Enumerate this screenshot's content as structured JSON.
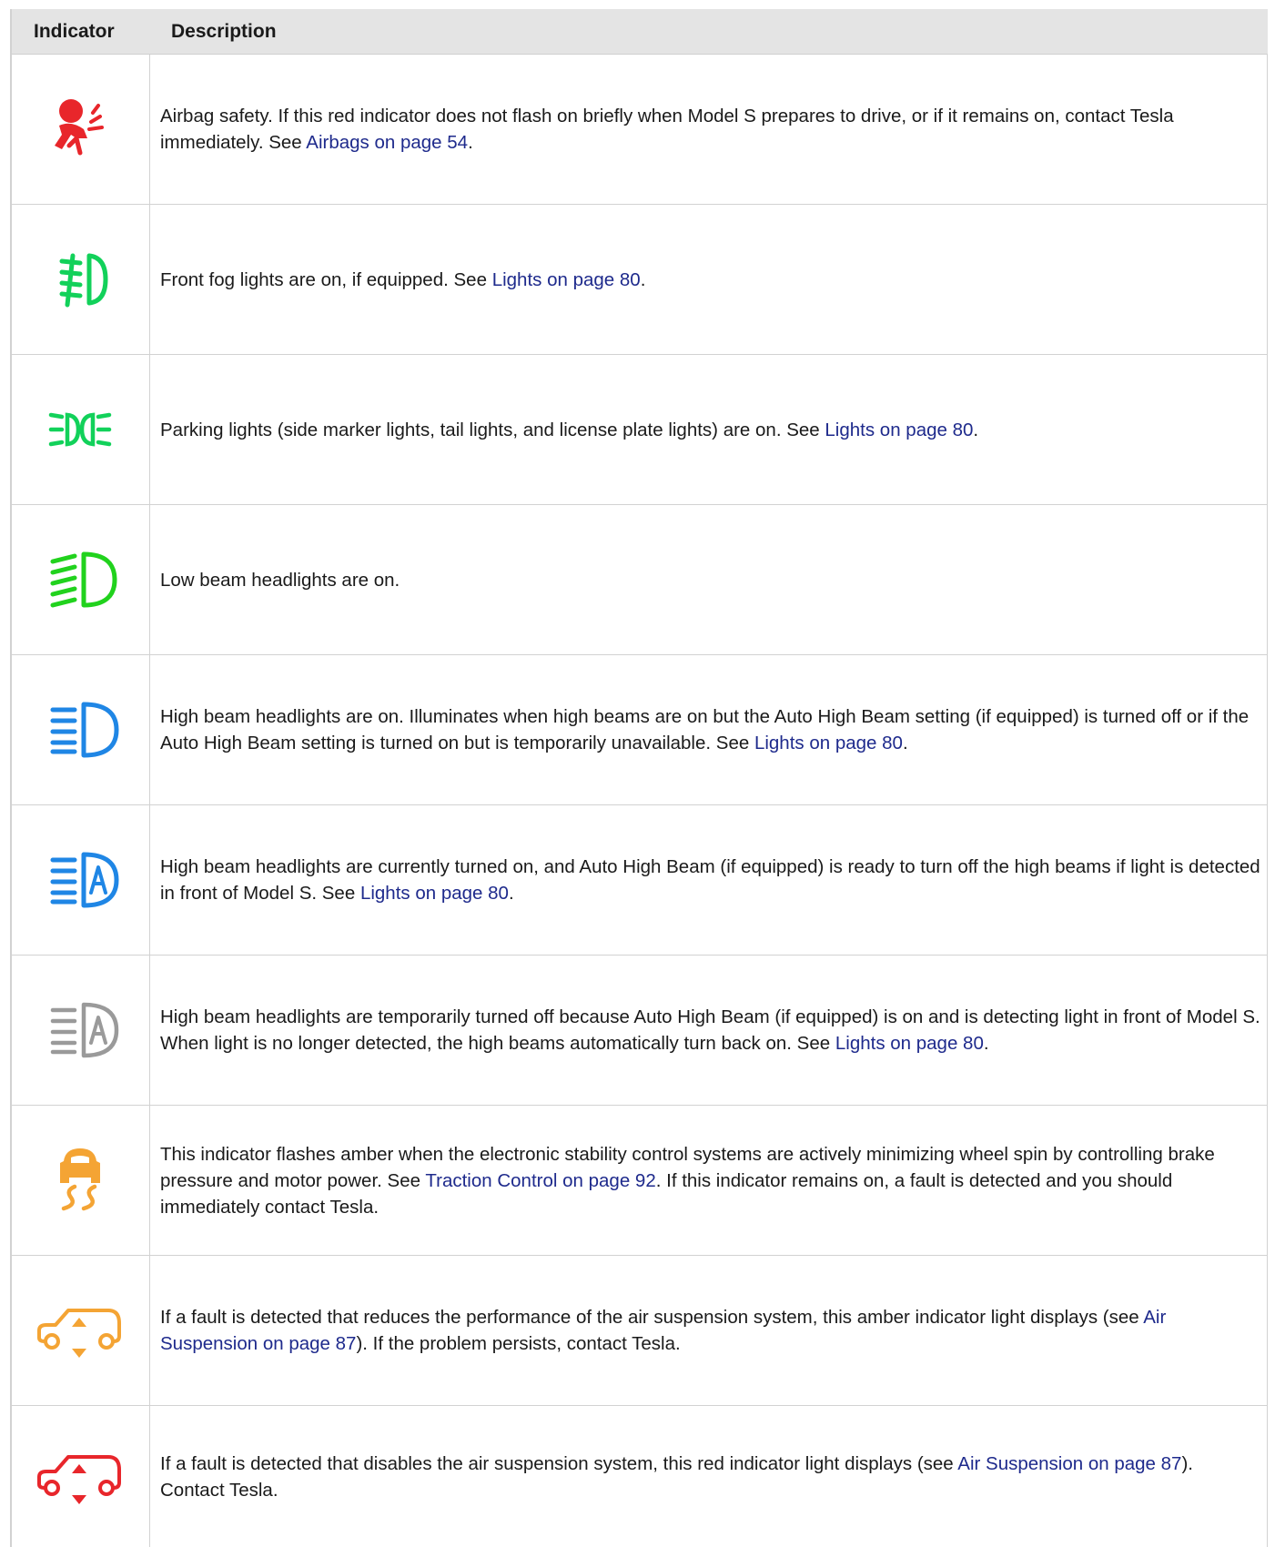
{
  "header": {
    "indicator": "Indicator",
    "description": "Description"
  },
  "colors": {
    "red": "#e8262b",
    "green": "#12d15a",
    "low_green": "#21d21d",
    "blue": "#1f86e5",
    "gray": "#9a9a9a",
    "amber": "#f4a434",
    "link": "#1e2a8c"
  },
  "rows": [
    {
      "icon": "airbag-icon",
      "pre": "Airbag safety. If this red indicator does not flash on briefly when Model S prepares to drive, or if it remains on, contact Tesla immediately. See ",
      "link": "Airbags on page 54",
      "post": "."
    },
    {
      "icon": "front-fog-light-icon",
      "pre": "Front fog lights are on, if equipped. See ",
      "link": "Lights on page 80",
      "post": "."
    },
    {
      "icon": "parking-lights-icon",
      "pre": "Parking lights (side marker lights, tail lights, and license plate lights) are on. See ",
      "link": "Lights on page 80",
      "post": "."
    },
    {
      "icon": "low-beam-icon",
      "pre": "Low beam headlights are on.",
      "link": "",
      "post": ""
    },
    {
      "icon": "high-beam-icon",
      "pre": "High beam headlights are on. Illuminates when high beams are on but the Auto High Beam setting (if equipped) is turned off or if the Auto High Beam setting is turned on but is temporarily unavailable. See ",
      "link": "Lights on page 80",
      "post": "."
    },
    {
      "icon": "auto-high-beam-icon",
      "pre": "High beam headlights are currently turned on, and Auto High Beam (if equipped) is ready to turn off the high beams if light is detected in front of Model S. See ",
      "link": "Lights on page 80",
      "post": "."
    },
    {
      "icon": "auto-high-beam-off-icon",
      "pre": "High beam headlights are temporarily turned off because Auto High Beam (if equipped) is on and is detecting light in front of Model S. When light is no longer detected, the high beams automatically turn back on. See ",
      "link": "Lights on page 80",
      "post": "."
    },
    {
      "icon": "traction-control-icon",
      "pre": "This indicator flashes amber when the electronic stability control systems are actively minimizing wheel spin by controlling brake pressure and motor power. See ",
      "link": "Traction Control on page 92",
      "post": ". If this indicator remains on, a fault is detected and you should immediately contact Tesla."
    },
    {
      "icon": "air-suspension-amber-icon",
      "pre": "If a fault is detected that reduces the performance of the air suspension system, this amber indicator light displays (see ",
      "link": "Air Suspension on page 87",
      "post": "). If the problem persists, contact Tesla."
    },
    {
      "icon": "air-suspension-red-icon",
      "pre": "If a fault is detected that disables the air suspension system, this red indicator light displays (see ",
      "link": "Air Suspension on page 87",
      "post": "). Contact Tesla."
    }
  ]
}
